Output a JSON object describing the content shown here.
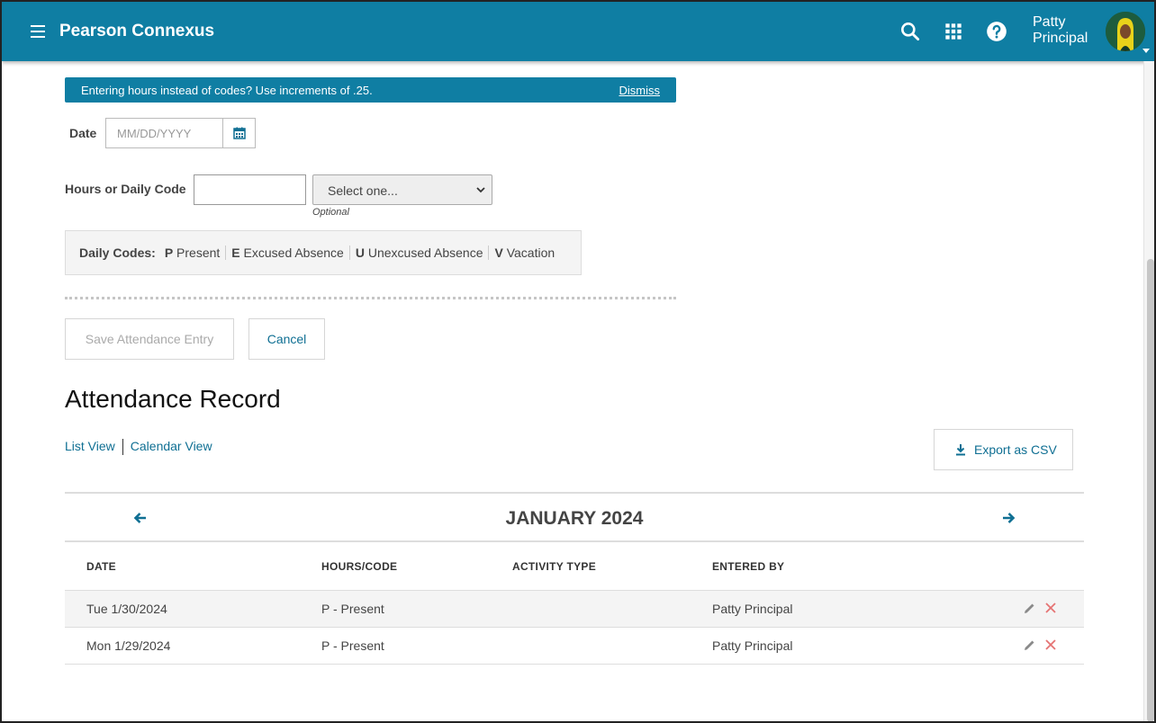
{
  "header": {
    "brand": "Pearson Connexus",
    "user_first": "Patty",
    "user_last": "Principal",
    "icons": [
      "menu-icon",
      "search-icon",
      "apps-grid-icon",
      "help-icon"
    ],
    "bar_color": "#0f7ea3"
  },
  "banner": {
    "message": "Entering hours instead of codes? Use increments of .25.",
    "dismiss": "Dismiss"
  },
  "form": {
    "date_label": "Date",
    "date_placeholder": "MM/DD/YYYY",
    "hours_label": "Hours or Daily Code",
    "hours_value": "",
    "select_value": "Select one...",
    "optional_note": "Optional",
    "codes_label": "Daily Codes:",
    "codes": [
      {
        "key": "P",
        "label": "Present"
      },
      {
        "key": "E",
        "label": "Excused Absence"
      },
      {
        "key": "U",
        "label": "Unexcused Absence"
      },
      {
        "key": "V",
        "label": "Vacation"
      }
    ],
    "save_label": "Save Attendance Entry",
    "cancel_label": "Cancel"
  },
  "record": {
    "title": "Attendance Record",
    "list_view": "List View",
    "calendar_view": "Calendar View",
    "export_label": "Export as CSV",
    "month": "JANUARY 2024",
    "columns": [
      "DATE",
      "HOURS/CODE",
      "ACTIVITY TYPE",
      "ENTERED BY"
    ],
    "rows": [
      {
        "date": "Tue 1/30/2024",
        "code": "P - Present",
        "activity": "",
        "entered_by": "Patty Principal"
      },
      {
        "date": "Mon 1/29/2024",
        "code": "P - Present",
        "activity": "",
        "entered_by": "Patty Principal"
      }
    ]
  },
  "colors": {
    "accent": "#0f7ea3",
    "link": "#0f6f93",
    "delete": "#e57373"
  }
}
